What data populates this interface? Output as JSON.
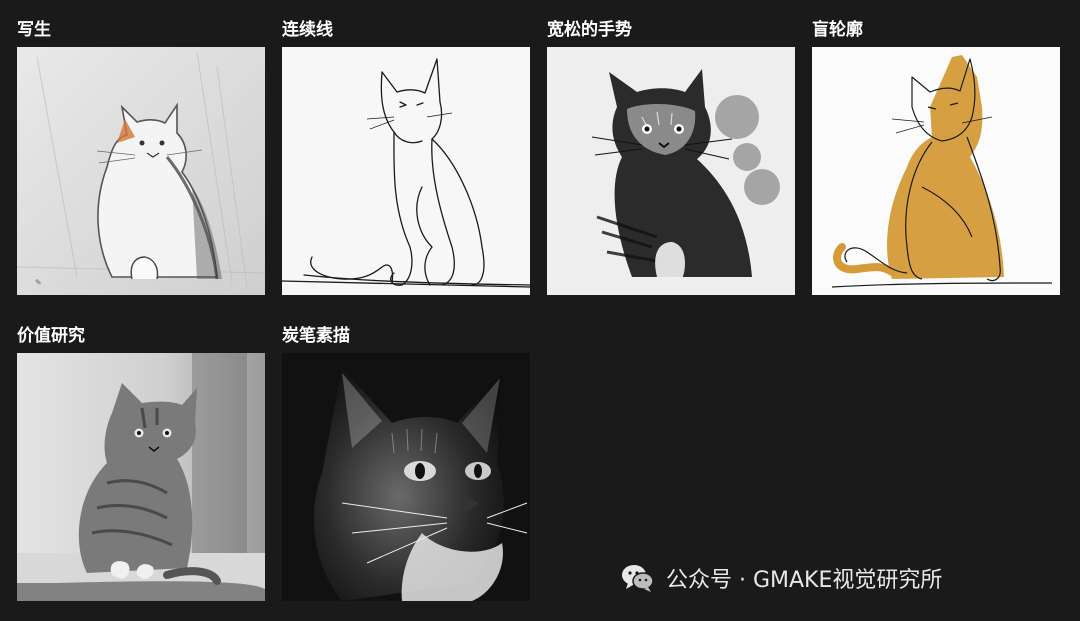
{
  "styles": [
    {
      "label": "写生",
      "image": "sketch-cat"
    },
    {
      "label": "连续线",
      "image": "continuous-line-cat"
    },
    {
      "label": "宽松的手势",
      "image": "loose-gesture-cat"
    },
    {
      "label": "盲轮廓",
      "image": "blind-contour-cat"
    },
    {
      "label": "价值研究",
      "image": "value-study-cat"
    },
    {
      "label": "炭笔素描",
      "image": "charcoal-cat"
    }
  ],
  "watermark": {
    "text": "公众号 · GMAKE视觉研究所",
    "icon": "wechat-icon"
  },
  "colors": {
    "background": "#1a1a1a",
    "label": "#ffffff",
    "ochre": "#d49b38"
  }
}
